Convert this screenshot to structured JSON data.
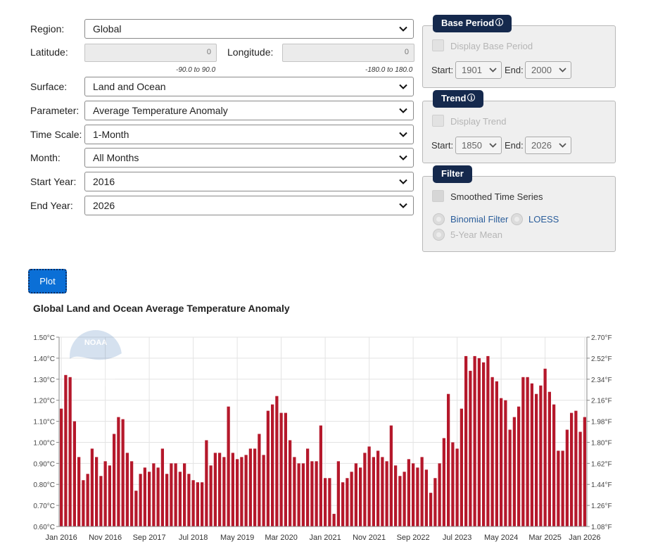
{
  "form": {
    "region": {
      "label": "Region:",
      "value": "Global"
    },
    "latitude": {
      "label": "Latitude:",
      "value": "0",
      "range": "-90.0 to 90.0"
    },
    "longitude": {
      "label": "Longitude:",
      "value": "0",
      "range": "-180.0 to 180.0"
    },
    "surface": {
      "label": "Surface:",
      "value": "Land and Ocean"
    },
    "parameter": {
      "label": "Parameter:",
      "value": "Average Temperature Anomaly"
    },
    "time_scale": {
      "label": "Time Scale:",
      "value": "1-Month"
    },
    "month": {
      "label": "Month:",
      "value": "All Months"
    },
    "start_year": {
      "label": "Start Year:",
      "value": "2016"
    },
    "end_year": {
      "label": "End Year:",
      "value": "2026"
    }
  },
  "base_period": {
    "title": "Base Period",
    "display_label": "Display Base Period",
    "start_label": "Start:",
    "start_value": "1901",
    "end_label": "End:",
    "end_value": "2000"
  },
  "trend": {
    "title": "Trend",
    "display_label": "Display Trend",
    "start_label": "Start:",
    "start_value": "1850",
    "end_label": "End:",
    "end_value": "2026"
  },
  "filter": {
    "title": "Filter",
    "smoothed_label": "Smoothed Time Series",
    "binomial_label": "Binomial Filter",
    "loess_label": "LOESS",
    "five_year_label": "5-Year Mean"
  },
  "plot_button": "Plot",
  "watermark": "NOAA",
  "colors": {
    "bar": "#b5182b",
    "pill": "#15294d",
    "plot_button": "#0b6fd6",
    "link": "#2a5d9a"
  },
  "chart_data": {
    "type": "bar",
    "title": "Global Land and Ocean Average Temperature Anomaly",
    "x_start": "Jan 2016",
    "x_ticks": [
      "Jan 2016",
      "Nov 2016",
      "Sep 2017",
      "Jul 2018",
      "May 2019",
      "Mar 2020",
      "Jan 2021",
      "Nov 2021",
      "Sep 2022",
      "Jul 2023",
      "May 2024",
      "Mar 2025",
      "Jan 2026"
    ],
    "y_left_ticks": [
      "1.50°C",
      "1.40°C",
      "1.30°C",
      "1.20°C",
      "1.10°C",
      "1.00°C",
      "0.90°C",
      "0.80°C",
      "0.70°C",
      "0.60°C"
    ],
    "y_right_ticks": [
      "2.70°F",
      "2.52°F",
      "2.34°F",
      "2.16°F",
      "1.98°F",
      "1.80°F",
      "1.62°F",
      "1.44°F",
      "1.26°F",
      "1.08°F"
    ],
    "ylim": [
      0.6,
      1.5
    ],
    "grid": true,
    "unit": "°C",
    "values": [
      1.16,
      1.32,
      1.31,
      1.1,
      0.93,
      0.82,
      0.85,
      0.97,
      0.93,
      0.84,
      0.91,
      0.89,
      1.04,
      1.12,
      1.11,
      0.95,
      0.91,
      0.77,
      0.85,
      0.88,
      0.86,
      0.9,
      0.88,
      0.97,
      0.85,
      0.9,
      0.9,
      0.86,
      0.9,
      0.85,
      0.82,
      0.81,
      0.81,
      1.01,
      0.89,
      0.95,
      0.95,
      0.93,
      1.17,
      0.95,
      0.92,
      0.93,
      0.94,
      0.97,
      0.97,
      1.04,
      0.94,
      1.15,
      1.18,
      1.22,
      1.14,
      1.14,
      1.01,
      0.93,
      0.9,
      0.9,
      0.97,
      0.91,
      0.91,
      1.08,
      0.83,
      0.83,
      0.66,
      0.91,
      0.81,
      0.83,
      0.86,
      0.9,
      0.88,
      0.95,
      0.98,
      0.93,
      0.96,
      0.93,
      0.91,
      1.08,
      0.89,
      0.84,
      0.86,
      0.92,
      0.9,
      0.88,
      0.93,
      0.87,
      0.76,
      0.83,
      0.9,
      1.02,
      1.23,
      1.0,
      0.97,
      1.16,
      1.41,
      1.34,
      1.41,
      1.4,
      1.38,
      1.41,
      1.31,
      1.29,
      1.21,
      1.2,
      1.06,
      1.12,
      1.17,
      1.31,
      1.31,
      1.28,
      1.23,
      1.27,
      1.35,
      1.24,
      1.18,
      0.96,
      0.96,
      1.06,
      1.14,
      1.15,
      1.05,
      1.12
    ]
  }
}
